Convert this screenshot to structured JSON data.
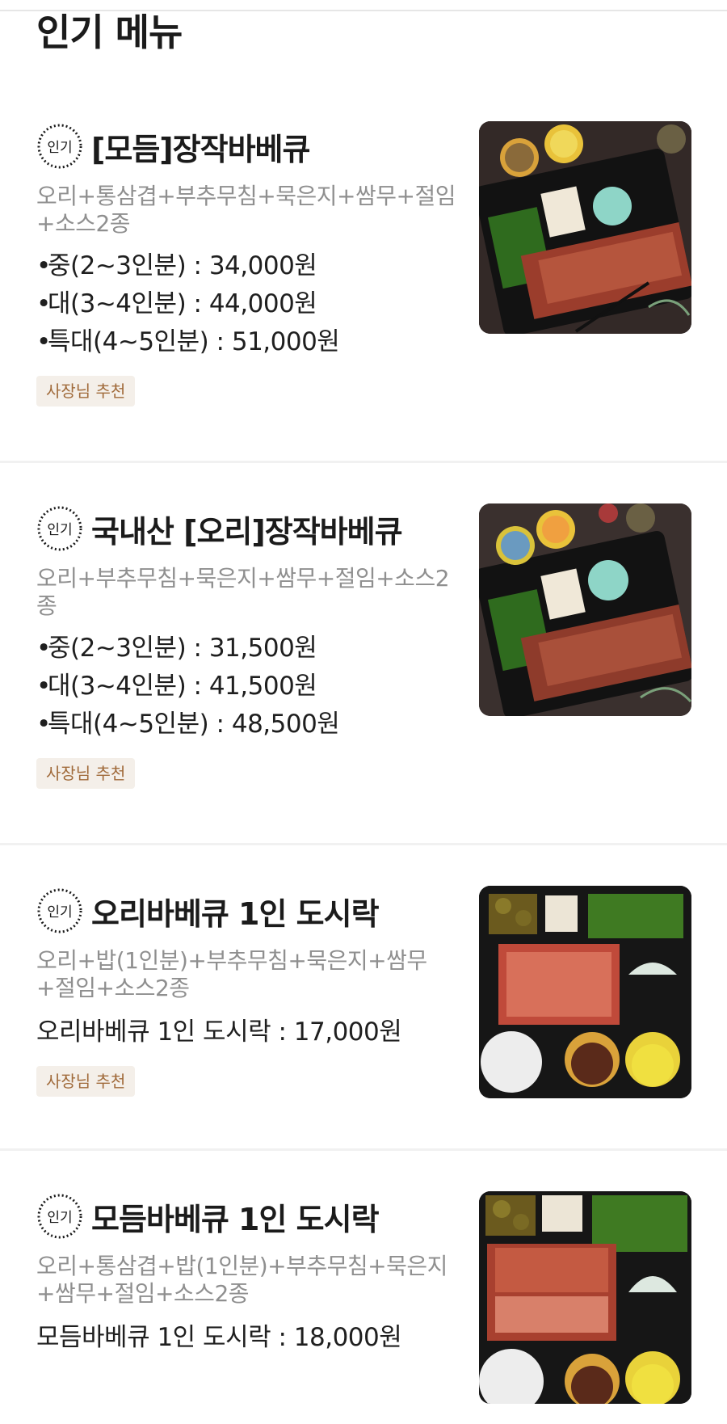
{
  "page": {
    "section_title": "인기 메뉴",
    "badge_text": "인기",
    "recommend_label": "사장님 추천"
  },
  "menus": [
    {
      "name": "[모듬]장작바베큐",
      "desc": "오리+통삼겹+부추무침+묵은지+쌈무+절임+소스2종",
      "prices": [
        {
          "bullet": "•",
          "text": "중(2~3인분) : 34,000원"
        },
        {
          "bullet": "•",
          "text": "대(3~4인분) : 44,000원"
        },
        {
          "bullet": "•",
          "text": "특대(4~5인분) : 51,000원"
        }
      ],
      "price_single": "",
      "recommended": true
    },
    {
      "name": "국내산 [오리]장작바베큐",
      "desc": "오리+부추무침+묵은지+쌈무+절임+소스2종",
      "prices": [
        {
          "bullet": "•",
          "text": "중(2~3인분) : 31,500원"
        },
        {
          "bullet": "•",
          "text": "대(3~4인분) : 41,500원"
        },
        {
          "bullet": "•",
          "text": "특대(4~5인분) : 48,500원"
        }
      ],
      "price_single": "",
      "recommended": true
    },
    {
      "name": "오리바베큐 1인 도시락",
      "desc": "오리+밥(1인분)+부추무침+묵은지+쌈무+절임+소스2종",
      "prices": [],
      "price_single": "오리바베큐 1인 도시락 : 17,000원",
      "recommended": true
    },
    {
      "name": "모듬바베큐 1인 도시락",
      "desc": "오리+통삼겹+밥(1인분)+부추무침+묵은지+쌈무+절임+소스2종",
      "prices": [],
      "price_single": "모듬바베큐 1인 도시락 : 18,000원",
      "recommended": false
    }
  ],
  "colors": {
    "accent_tag_bg": "#f4efe9",
    "accent_tag_text": "#a06a3a",
    "desc_text": "#8f8f8f"
  }
}
